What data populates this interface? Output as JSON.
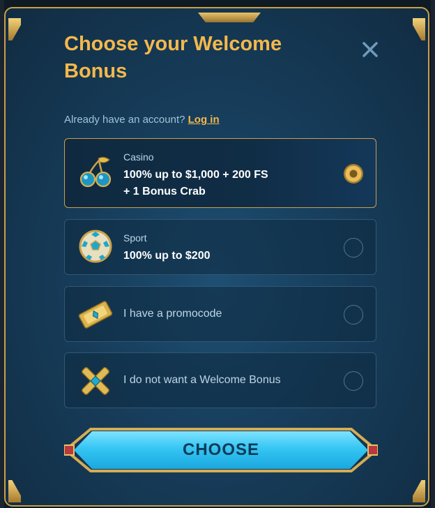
{
  "modal": {
    "title": "Choose your Welcome Bonus",
    "account_text": "Already have an account?",
    "login_link": "Log in"
  },
  "options": [
    {
      "category": "Casino",
      "bonus_line1": "100% up to $1,000 + 200 FS",
      "bonus_line2": "+ 1 Bonus Crab",
      "icon": "cherries-icon",
      "selected": true
    },
    {
      "category": "Sport",
      "bonus_line1": "100% up to $200",
      "icon": "soccer-ball-icon",
      "selected": false
    },
    {
      "label": "I have a promocode",
      "icon": "ticket-icon",
      "selected": false
    },
    {
      "label": "I do not want a Welcome Bonus",
      "icon": "cross-icon",
      "selected": false
    }
  ],
  "choose_button": {
    "label": "CHOOSE"
  },
  "colors": {
    "accent_gold": "#f4b84c",
    "button_cyan": "#35c6f3",
    "panel": "#18405f"
  }
}
